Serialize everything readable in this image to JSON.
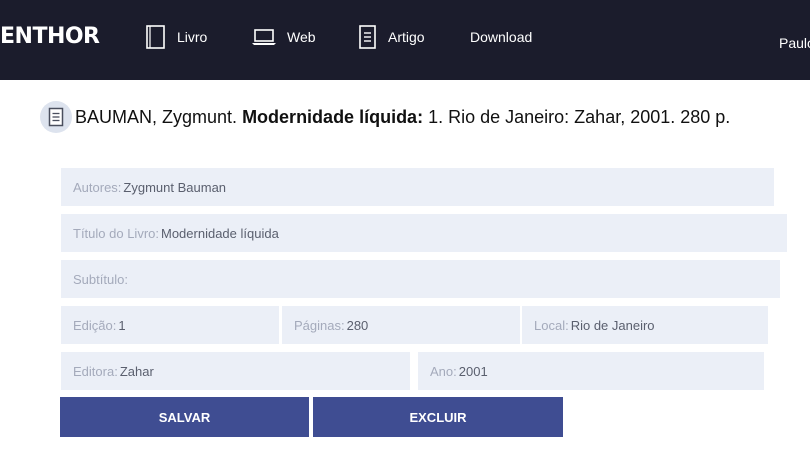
{
  "header": {
    "logo": "ENTHOR",
    "nav": [
      {
        "label": "Livro",
        "icon": "book-icon"
      },
      {
        "label": "Web",
        "icon": "laptop-icon"
      },
      {
        "label": "Artigo",
        "icon": "document-icon"
      },
      {
        "label": "Download",
        "icon": ""
      }
    ],
    "user": "Paulo"
  },
  "reference": {
    "icon": "document-icon",
    "authors": "BAUMAN, Zygmunt.",
    "title": "Modernidade líquida:",
    "rest": "1. Rio de Janeiro: Zahar, 2001. 280 p."
  },
  "form": {
    "autores": {
      "label": "Autores:",
      "value": "Zygmunt Bauman"
    },
    "titulo": {
      "label": "Título do Livro:",
      "value": "Modernidade líquida"
    },
    "subtitulo": {
      "label": "Subtítulo:",
      "value": ""
    },
    "edicao": {
      "label": "Edição:",
      "value": "1"
    },
    "paginas": {
      "label": "Páginas:",
      "value": "280"
    },
    "local": {
      "label": "Local:",
      "value": "Rio de Janeiro"
    },
    "editora": {
      "label": "Editora:",
      "value": "Zahar"
    },
    "ano": {
      "label": "Ano:",
      "value": "2001"
    }
  },
  "buttons": {
    "save": "SALVAR",
    "delete": "EXCLUIR"
  },
  "colors": {
    "header_bg": "#1b1c2c",
    "field_bg": "#ebeff7",
    "button_bg": "#3f4d92"
  }
}
